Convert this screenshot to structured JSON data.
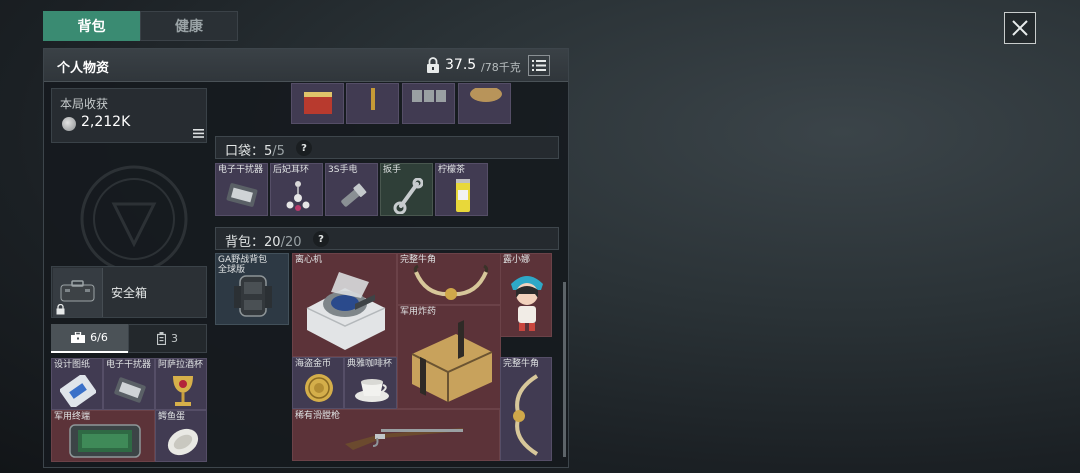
{
  "tabs": [
    {
      "label": "背包",
      "active": true
    },
    {
      "label": "健康",
      "active": false
    }
  ],
  "panel": {
    "title": "个人物资",
    "weight_current": "37.5",
    "weight_max": "/78千克"
  },
  "loot": {
    "label": "本局收获",
    "value": "2,212K"
  },
  "safe": {
    "label": "安全箱"
  },
  "mini_tabs": [
    {
      "count": "6/6",
      "icon": "toolbox-icon"
    },
    {
      "count": "3",
      "icon": "canister-icon"
    }
  ],
  "safe_items": [
    {
      "label": "设计图纸",
      "rarity": "purple",
      "icon": "blueprint-icon"
    },
    {
      "label": "电子干扰器",
      "rarity": "purple",
      "icon": "jammer-icon"
    },
    {
      "label": "阿萨拉酒杯",
      "rarity": "purple",
      "icon": "goblet-icon"
    },
    {
      "label": "军用终端",
      "rarity": "red",
      "icon": "terminal-icon"
    },
    {
      "label": "鳄鱼蛋",
      "rarity": "purple",
      "icon": "crocodile-egg-icon"
    }
  ],
  "pocket": {
    "label": "口袋：",
    "used": "5",
    "capacity": "/5",
    "help": "?",
    "items": [
      {
        "label": "电子干扰器",
        "rarity": "purple",
        "icon": "jammer-icon"
      },
      {
        "label": "后妃耳环",
        "rarity": "purple",
        "icon": "earring-icon"
      },
      {
        "label": "3S手电",
        "rarity": "purple",
        "icon": "flashlight-icon"
      },
      {
        "label": "扳手",
        "rarity": "green",
        "icon": "wrench-icon"
      },
      {
        "label": "柠檬茶",
        "rarity": "purple",
        "icon": "lemon-tea-icon"
      }
    ]
  },
  "backpack": {
    "label": "背包：",
    "used": "20",
    "capacity": "/20",
    "help": "?",
    "items": [
      {
        "label": "GA野战背包",
        "sub": "全球版",
        "rarity": "blue",
        "icon": "backpack-icon"
      },
      {
        "label": "离心机",
        "rarity": "red",
        "icon": "centrifuge-icon"
      },
      {
        "label": "完整牛角",
        "rarity": "red",
        "icon": "horn-icon"
      },
      {
        "label": "露小娜",
        "rarity": "red",
        "icon": "doll-icon"
      },
      {
        "label": "军用炸药",
        "rarity": "red",
        "icon": "explosive-crate-icon"
      },
      {
        "label": "海盗金币",
        "rarity": "purple",
        "icon": "gold-coin-icon"
      },
      {
        "label": "典雅咖啡杯",
        "rarity": "purple",
        "icon": "coffee-cup-icon"
      },
      {
        "label": "完整牛角",
        "rarity": "purple",
        "icon": "horn-icon"
      },
      {
        "label": "稀有滑膛枪",
        "rarity": "red",
        "icon": "musket-icon"
      }
    ]
  },
  "top_row_items": [
    {
      "rarity": "purple",
      "icon": "red-box-icon"
    },
    {
      "rarity": "purple",
      "icon": "gold-chain-icon"
    },
    {
      "rarity": "purple",
      "icon": "battery-pack-icon"
    },
    {
      "rarity": "purple",
      "icon": "bread-icon"
    }
  ],
  "colors": {
    "accent_tab": "#3a8b72",
    "rarity_red": "#5c3339",
    "rarity_purple": "#413b52",
    "rarity_green": "#2f3f38",
    "rarity_blue": "#2d3944"
  }
}
